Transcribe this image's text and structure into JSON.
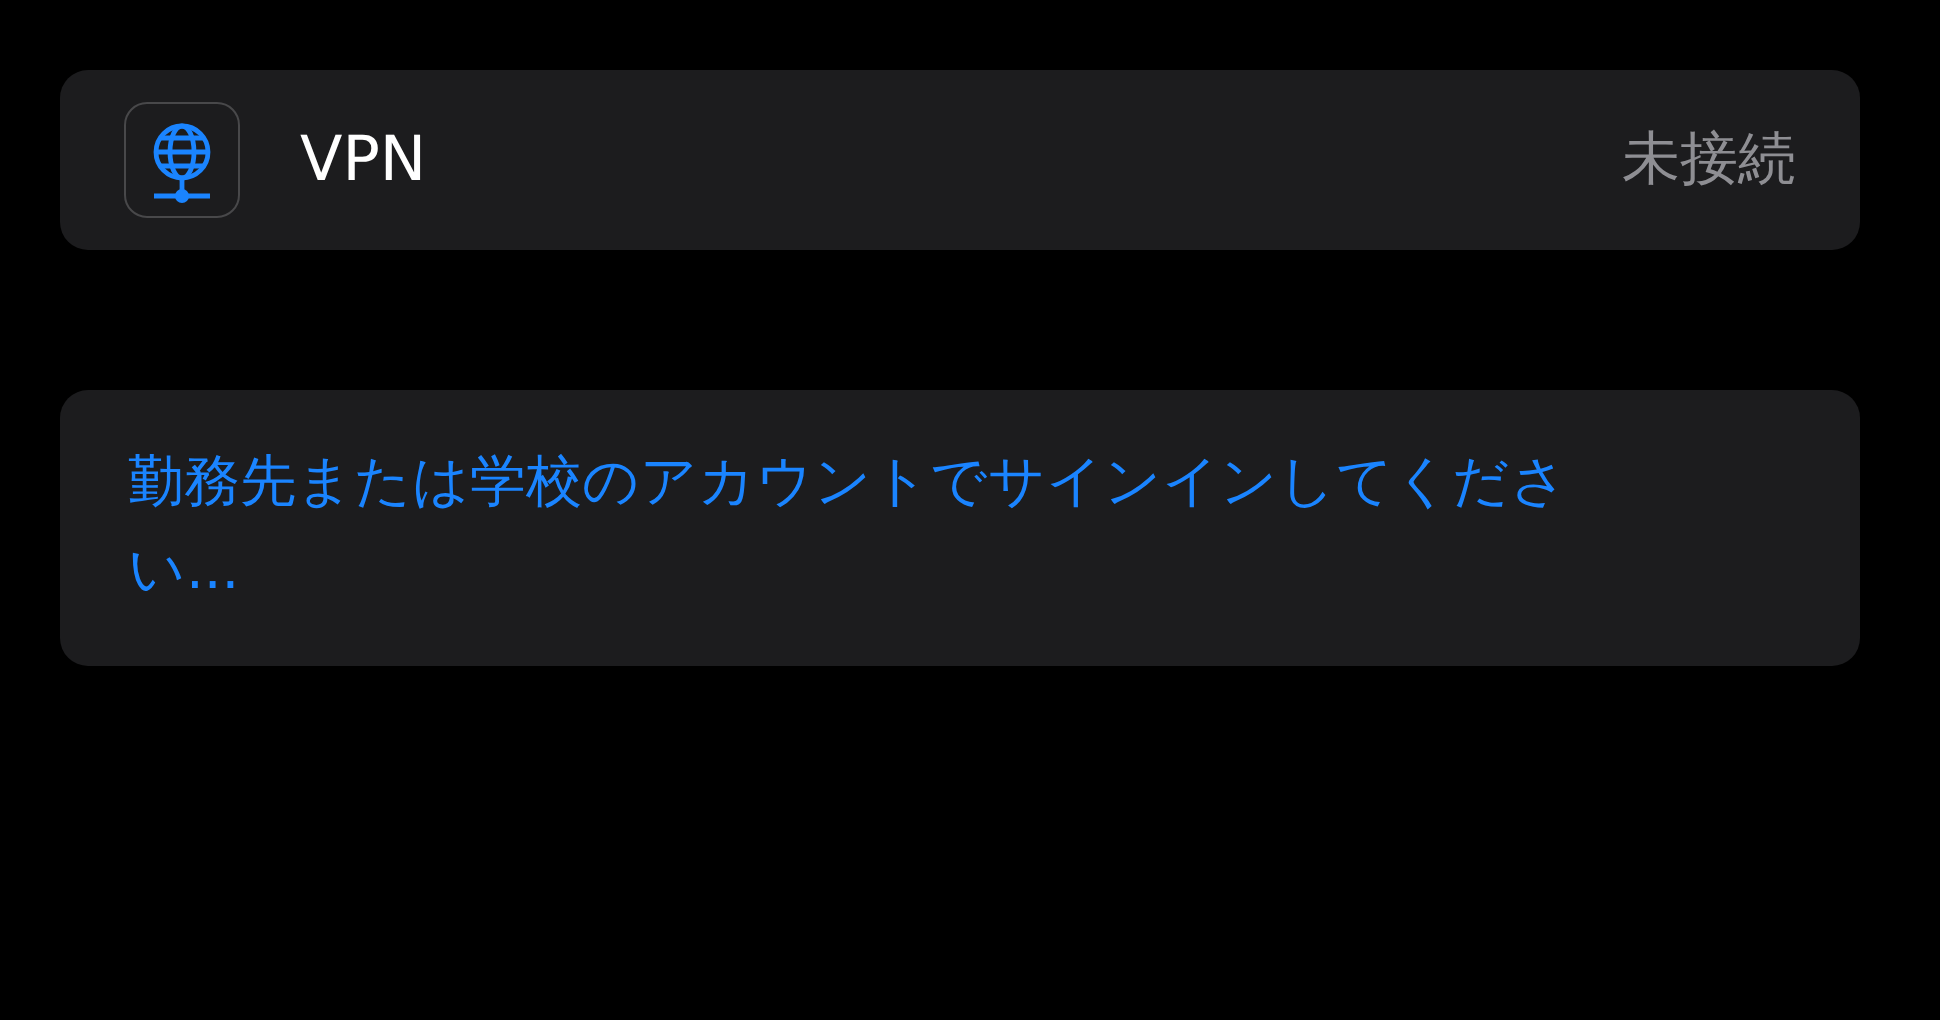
{
  "vpn_row": {
    "label": "VPN",
    "status": "未接続"
  },
  "sign_in_link": "勤務先または学校のアカウントでサインインしてください..."
}
